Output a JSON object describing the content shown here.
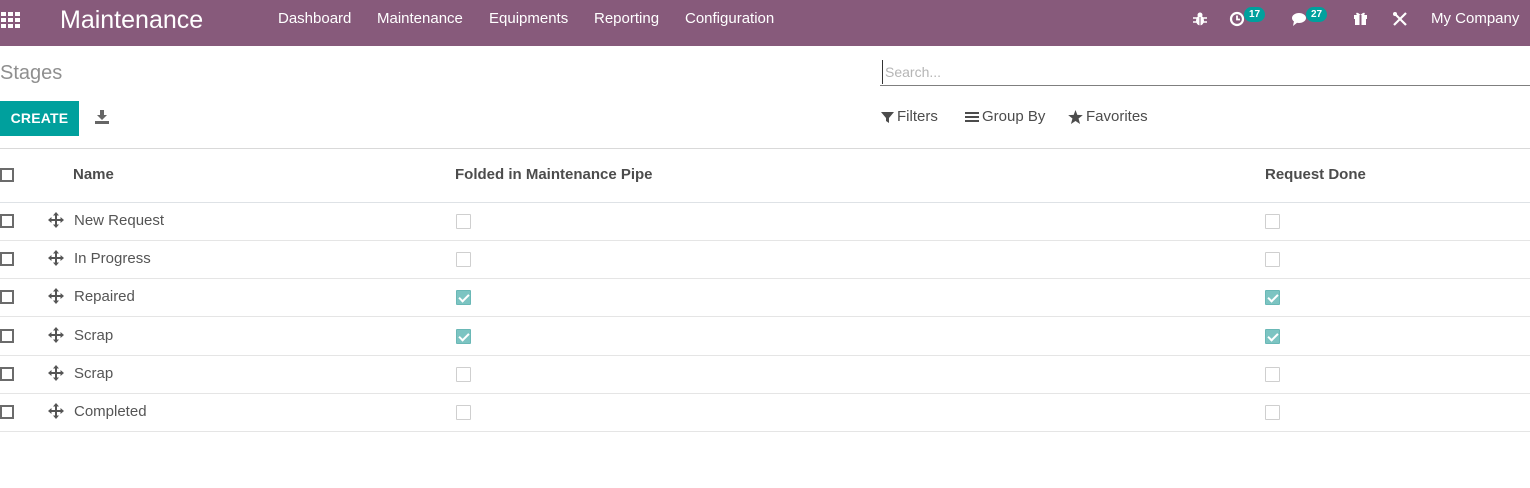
{
  "navbar": {
    "app_title": "Maintenance",
    "menus": [
      "Dashboard",
      "Maintenance",
      "Equipments",
      "Reporting",
      "Configuration"
    ],
    "activity_count": "17",
    "messages_count": "27",
    "company": "My Company",
    "icons": [
      "apps-grid-icon",
      "bug-icon",
      "clock-activity-icon",
      "chat-icon",
      "gift-icon",
      "tools-icon"
    ]
  },
  "control_panel": {
    "breadcrumb": "Stages",
    "search_placeholder": "Search...",
    "create_label": "CREATE",
    "filters_label": "Filters",
    "group_by_label": "Group By",
    "favorites_label": "Favorites"
  },
  "table": {
    "columns": [
      "Name",
      "Folded in Maintenance Pipe",
      "Request Done"
    ],
    "rows": [
      {
        "name": "New Request",
        "folded": false,
        "done": false
      },
      {
        "name": "In Progress",
        "folded": false,
        "done": false
      },
      {
        "name": "Repaired",
        "folded": true,
        "done": true
      },
      {
        "name": "Scrap",
        "folded": true,
        "done": true
      },
      {
        "name": "Scrap",
        "folded": false,
        "done": false
      },
      {
        "name": "Completed",
        "folded": false,
        "done": false
      }
    ]
  },
  "colors": {
    "navbar": "#875a7b",
    "primary": "#00a09d",
    "checked": "#7cc4c2"
  }
}
